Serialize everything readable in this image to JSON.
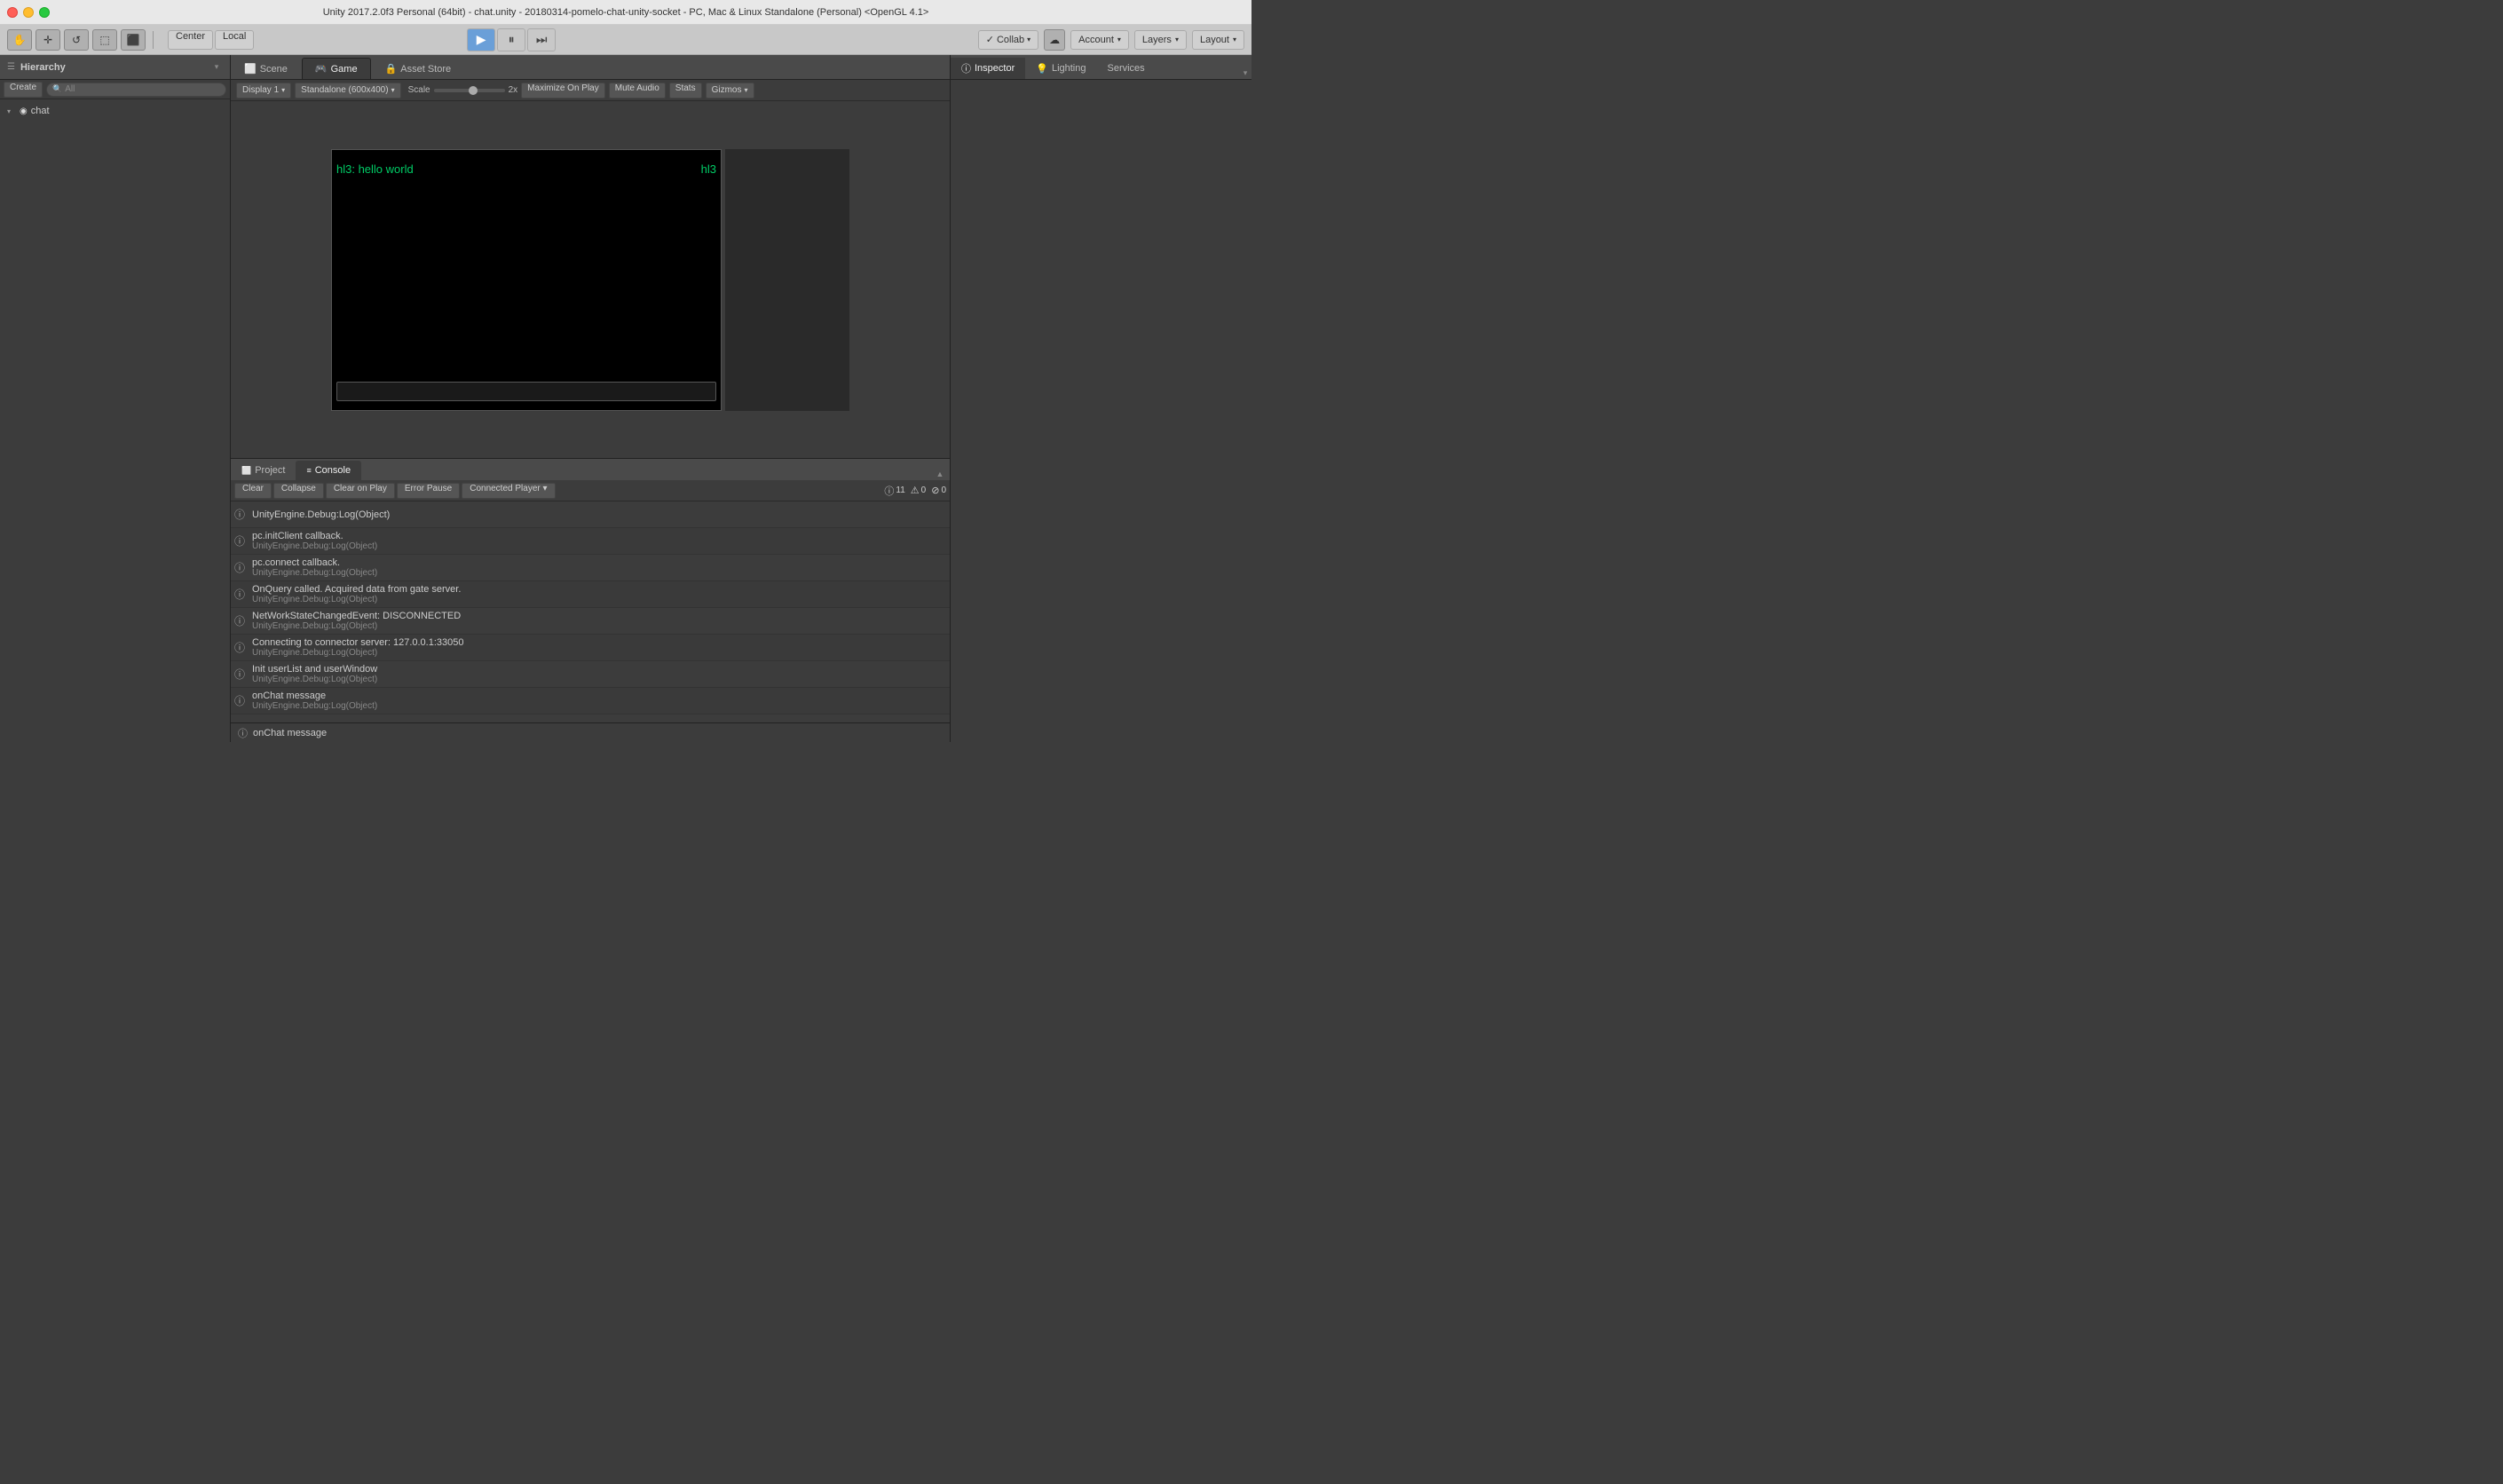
{
  "titleBar": {
    "title": "Unity 2017.2.0f3 Personal (64bit) - chat.unity - 20180314-pomelo-chat-unity-socket - PC, Mac & Linux Standalone (Personal) <OpenGL 4.1>"
  },
  "toolbar": {
    "tools": [
      "⊹",
      "✛",
      "↺",
      "⬚",
      "⬛"
    ],
    "center": "Center",
    "local": "Local",
    "play": "▶",
    "pause": "⏸",
    "step": "⏭",
    "collab": "Collab",
    "cloud_icon": "☁",
    "account": "Account",
    "layers": "Layers",
    "layout": "Layout"
  },
  "hierarchy": {
    "title": "Hierarchy",
    "create": "Create",
    "search_placeholder": "All",
    "items": [
      {
        "label": "chat",
        "icon": "◉",
        "expanded": true,
        "level": 0
      }
    ]
  },
  "tabs": {
    "scene": "Scene",
    "game": "Game",
    "asset_store": "Asset Store"
  },
  "gameView": {
    "display": "Display 1",
    "resolution": "Standalone (600x400)",
    "scale_label": "Scale",
    "scale_value": "2x",
    "maximize_on_play": "Maximize On Play",
    "mute_audio": "Mute Audio",
    "stats": "Stats",
    "gizmos": "Gizmos",
    "canvas": {
      "text_left": "hl3: hello world",
      "text_right": "hl3"
    }
  },
  "bottomTabs": {
    "project": "Project",
    "console": "Console"
  },
  "console": {
    "clear": "Clear",
    "collapse": "Collapse",
    "clear_on_play": "Clear on Play",
    "error_pause": "Error Pause",
    "connected_player": "Connected Player",
    "badges": {
      "info_icon": "ⓘ",
      "info_count": "11",
      "warn_icon": "⚠",
      "warn_count": "0",
      "error_icon": "⊘",
      "error_count": "0"
    },
    "logs": [
      {
        "main": "UnityEngine.Debug:Log(Object)",
        "sub": "",
        "icon": "ⓘ"
      },
      {
        "main": "pc.initClient callback.",
        "sub": "UnityEngine.Debug:Log(Object)",
        "icon": "ⓘ"
      },
      {
        "main": "pc.connect callback.",
        "sub": "UnityEngine.Debug:Log(Object)",
        "icon": "ⓘ"
      },
      {
        "main": "OnQuery called. Acquired data from gate server.",
        "sub": "UnityEngine.Debug:Log(Object)",
        "icon": "ⓘ"
      },
      {
        "main": "NetWorkStateChangedEvent: DISCONNECTED",
        "sub": "UnityEngine.Debug:Log(Object)",
        "icon": "ⓘ"
      },
      {
        "main": "Connecting to connector server: 127.0.0.1:33050",
        "sub": "UnityEngine.Debug:Log(Object)",
        "icon": "ⓘ"
      },
      {
        "main": "Init userList and userWindow",
        "sub": "UnityEngine.Debug:Log(Object)",
        "icon": "ⓘ"
      },
      {
        "main": "onChat message",
        "sub": "UnityEngine.Debug:Log(Object)",
        "icon": "ⓘ"
      }
    ],
    "status_message": "onChat message"
  },
  "inspector": {
    "title": "Inspector",
    "tabs": [
      "Inspector",
      "Lighting",
      "Services"
    ]
  }
}
